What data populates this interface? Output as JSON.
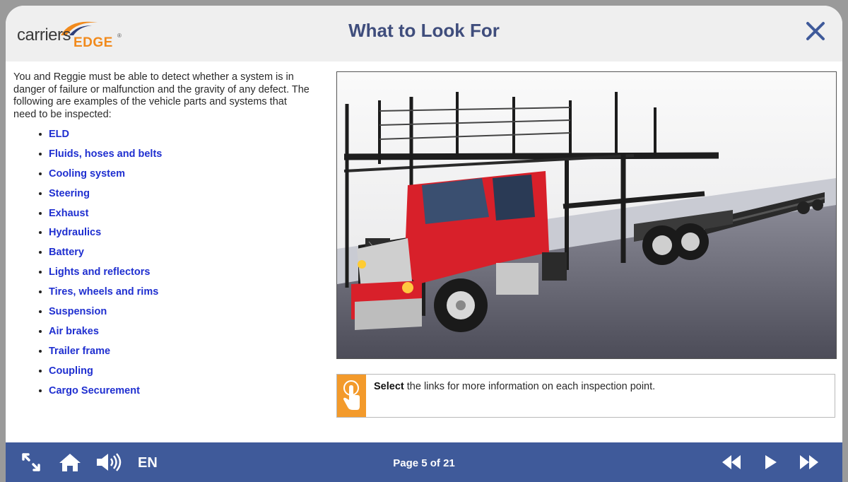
{
  "header": {
    "logo_word1": "carriers",
    "logo_word2": "EDGE",
    "logo_reg": "®",
    "title": "What to Look For"
  },
  "intro": "You and Reggie must be able to detect whether a system is in danger of failure or malfunction and the gravity of any defect. The following are examples of the vehicle parts and systems that need to be inspected:",
  "links": [
    "ELD",
    "Fluids, hoses and belts",
    "Cooling system",
    "Steering",
    "Exhaust",
    "Hydraulics",
    "Battery",
    "Lights and reflectors",
    "Tires, wheels and rims",
    "Suspension",
    "Air brakes",
    "Trailer frame",
    "Coupling",
    "Cargo Securement"
  ],
  "tip": {
    "bold": "Select",
    "rest": " the links for more information on each inspection point."
  },
  "footer": {
    "language": "EN",
    "page_label": "Page 5 of 21"
  },
  "colors": {
    "title": "#3f4d7c",
    "link": "#1f2fd0",
    "footer_bg": "#3f5a9a",
    "accent": "#f39a2b",
    "truck_cab": "#d8202a"
  },
  "icons": [
    "close-icon",
    "expand-icon",
    "home-icon",
    "volume-icon",
    "pointer-hand-icon",
    "rewind-icon",
    "play-icon",
    "fast-forward-icon"
  ]
}
